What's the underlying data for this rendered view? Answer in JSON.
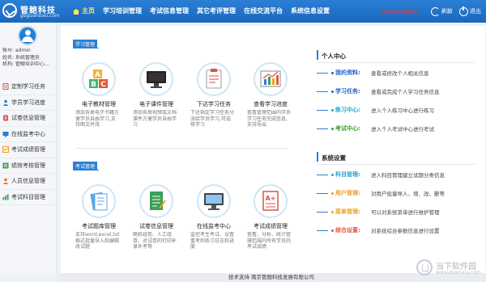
{
  "brand": {
    "title": "管鲍科技",
    "subtitle": "gbguanbao.com"
  },
  "nav": {
    "items": [
      {
        "label": "主页"
      },
      {
        "label": "学习培训管理"
      },
      {
        "label": "考试信息管理"
      },
      {
        "label": "其它考评管理"
      },
      {
        "label": "在线交流平台"
      },
      {
        "label": "系统信息设置"
      }
    ]
  },
  "topright": {
    "welcome": "欢迎来到管理中心",
    "refresh_label": "刷新",
    "exit_label": "退出"
  },
  "user": {
    "account": "帐号: admin",
    "name": "姓名: 系统管理员",
    "org": "机构: 管鲍培训中心..."
  },
  "sidebar": {
    "items": [
      {
        "label": "定制学习任务",
        "icon": "task-icon",
        "color": "#e05a3a"
      },
      {
        "label": "学员学习进度",
        "icon": "progress-icon",
        "color": "#2a7fd4"
      },
      {
        "label": "试卷信息管理",
        "icon": "paper-icon",
        "color": "#d9534f"
      },
      {
        "label": "在线监考中心",
        "icon": "monitor-icon",
        "color": "#2a7fd4"
      },
      {
        "label": "考试成绩管理",
        "icon": "grade-icon",
        "color": "#f0a020"
      },
      {
        "label": "绩效考核管理",
        "icon": "kpi-icon",
        "color": "#3aa055"
      },
      {
        "label": "人员信息管理",
        "icon": "people-icon",
        "color": "#e07a20"
      },
      {
        "label": "考试科目管理",
        "icon": "subject-icon",
        "color": "#3aa055"
      }
    ]
  },
  "study": {
    "section_label": "学习管理",
    "cards": [
      {
        "title": "电子教材管理",
        "desc": [
          "添加各类电子书籍方",
          "便学员自由学习,支",
          "持图文并茂"
        ],
        "icon": "abc-blocks-icon"
      },
      {
        "title": "电子课件管理",
        "desc": [
          "添加各类视频或文档",
          "课件方便学员自由学",
          "习"
        ],
        "icon": "monitor-icon"
      },
      {
        "title": "下达学习任务",
        "desc": [
          "下达指定学习任务分",
          "派给学员学习,可选",
          "修学习"
        ],
        "icon": "clipboard-icon"
      },
      {
        "title": "查看学习进度",
        "desc": [
          "查看管理范围内学员",
          "学习任务完成信息,",
          "支持导出"
        ],
        "icon": "chart-icon"
      }
    ]
  },
  "exam": {
    "section_label": "考试管理",
    "cards": [
      {
        "title": "考试题库管理",
        "desc": [
          "支持word,excel,txt",
          "格式批量导入和编辑",
          "改试题"
        ],
        "icon": "question-bank-icon"
      },
      {
        "title": "试卷信息管理",
        "desc": [
          "随机组卷、人工组",
          "卷、对试卷的打印补",
          "录补考等"
        ],
        "icon": "document-icon"
      },
      {
        "title": "在线监考中心",
        "desc": [
          "监控考生考试、设置",
          "重考和练习日志和进",
          "度"
        ],
        "icon": "monitor-icon"
      },
      {
        "title": "考试成绩管理",
        "desc": [
          "查看、分析、统计管",
          "辖范围内所有学员的",
          "考试成绩"
        ],
        "icon": "grade-report-icon"
      }
    ]
  },
  "personal": {
    "heading": "个人中心",
    "rows": [
      {
        "key": "我的资料:",
        "value": "查看或修改个人相关信息",
        "color": "#1e63c8"
      },
      {
        "key": "学习任务:",
        "value": "查看或完成个人学习任务信息",
        "color": "#1e63c8"
      },
      {
        "key": "练习中心:",
        "value": "进入个人练习中心进行练习",
        "color": "#1ea7c8"
      },
      {
        "key": "考试中心:",
        "value": "进入个人考试中心进行考试",
        "color": "#3aa020"
      }
    ]
  },
  "system": {
    "heading": "系统设置",
    "rows": [
      {
        "key": "科目管理:",
        "value": "进入科目管理建立试题分类信息",
        "color": "#1ea7c8"
      },
      {
        "key": "用户管理:",
        "value": "对用户批量导入、增、改、删等",
        "color": "#e8a020"
      },
      {
        "key": "菜单管理:",
        "value": "可以对系统菜单进行维护管理",
        "color": "#e8a020"
      },
      {
        "key": "综合设置:",
        "value": "对系统综合参数信息进行设置",
        "color": "#e05a3a"
      }
    ]
  },
  "footer": {
    "text": "技术支持 南京管鲍科技发展有限公司"
  },
  "watermark": {
    "title": "当下软件园",
    "sub": "www.downxia.com"
  }
}
